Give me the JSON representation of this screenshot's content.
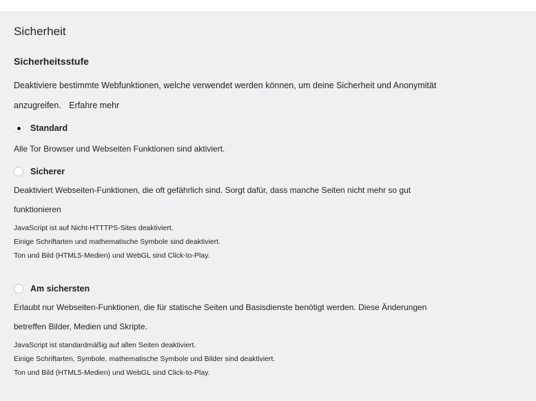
{
  "page_title": "Sicherheit",
  "security_level": {
    "heading": "Sicherheitsstufe",
    "description_line1": "Deaktiviere bestimmte Webfunktionen, welche verwendet werden können, um deine Sicherheit und Anonymität",
    "description_line2": "anzugreifen.",
    "learn_more": "Erfahre mehr",
    "options": [
      {
        "label": "Standard",
        "selected": true,
        "description": "Alle Tor Browser und Webseiten Funktionen sind aktiviert.",
        "details": []
      },
      {
        "label": "Sicherer",
        "selected": false,
        "description_line1": "Deaktiviert Webseiten-Funktionen, die oft gefährlich sind. Sorgt dafür, dass manche Seiten nicht mehr so gut",
        "description_line2": "funktionieren",
        "details": [
          "JavaScript ist auf Nicht-HTTTPS-Sites deaktiviert.",
          "Einige Schriftarten und mathematische Symbole sind deaktiviert.",
          "Ton und Bild (HTML5-Medien) und WebGL sind Click-to-Play."
        ]
      },
      {
        "label": "Am sichersten",
        "selected": false,
        "description_line1": "Erlaubt nur Webseiten-Funktionen, die für statische Seiten und Basisdienste benötigt werden. Diese Änderungen",
        "description_line2": "betreffen Bilder, Medien und Skripte.",
        "details": [
          "JavaScript ist standardmäßig auf allen Seiten deaktiviert.",
          "Einige Schriftarten, Symbole, mathematische Symbole und Bilder sind deaktiviert.",
          "Ton und Bild (HTML5-Medien) und WebGL sind Click-to-Play."
        ]
      }
    ]
  }
}
